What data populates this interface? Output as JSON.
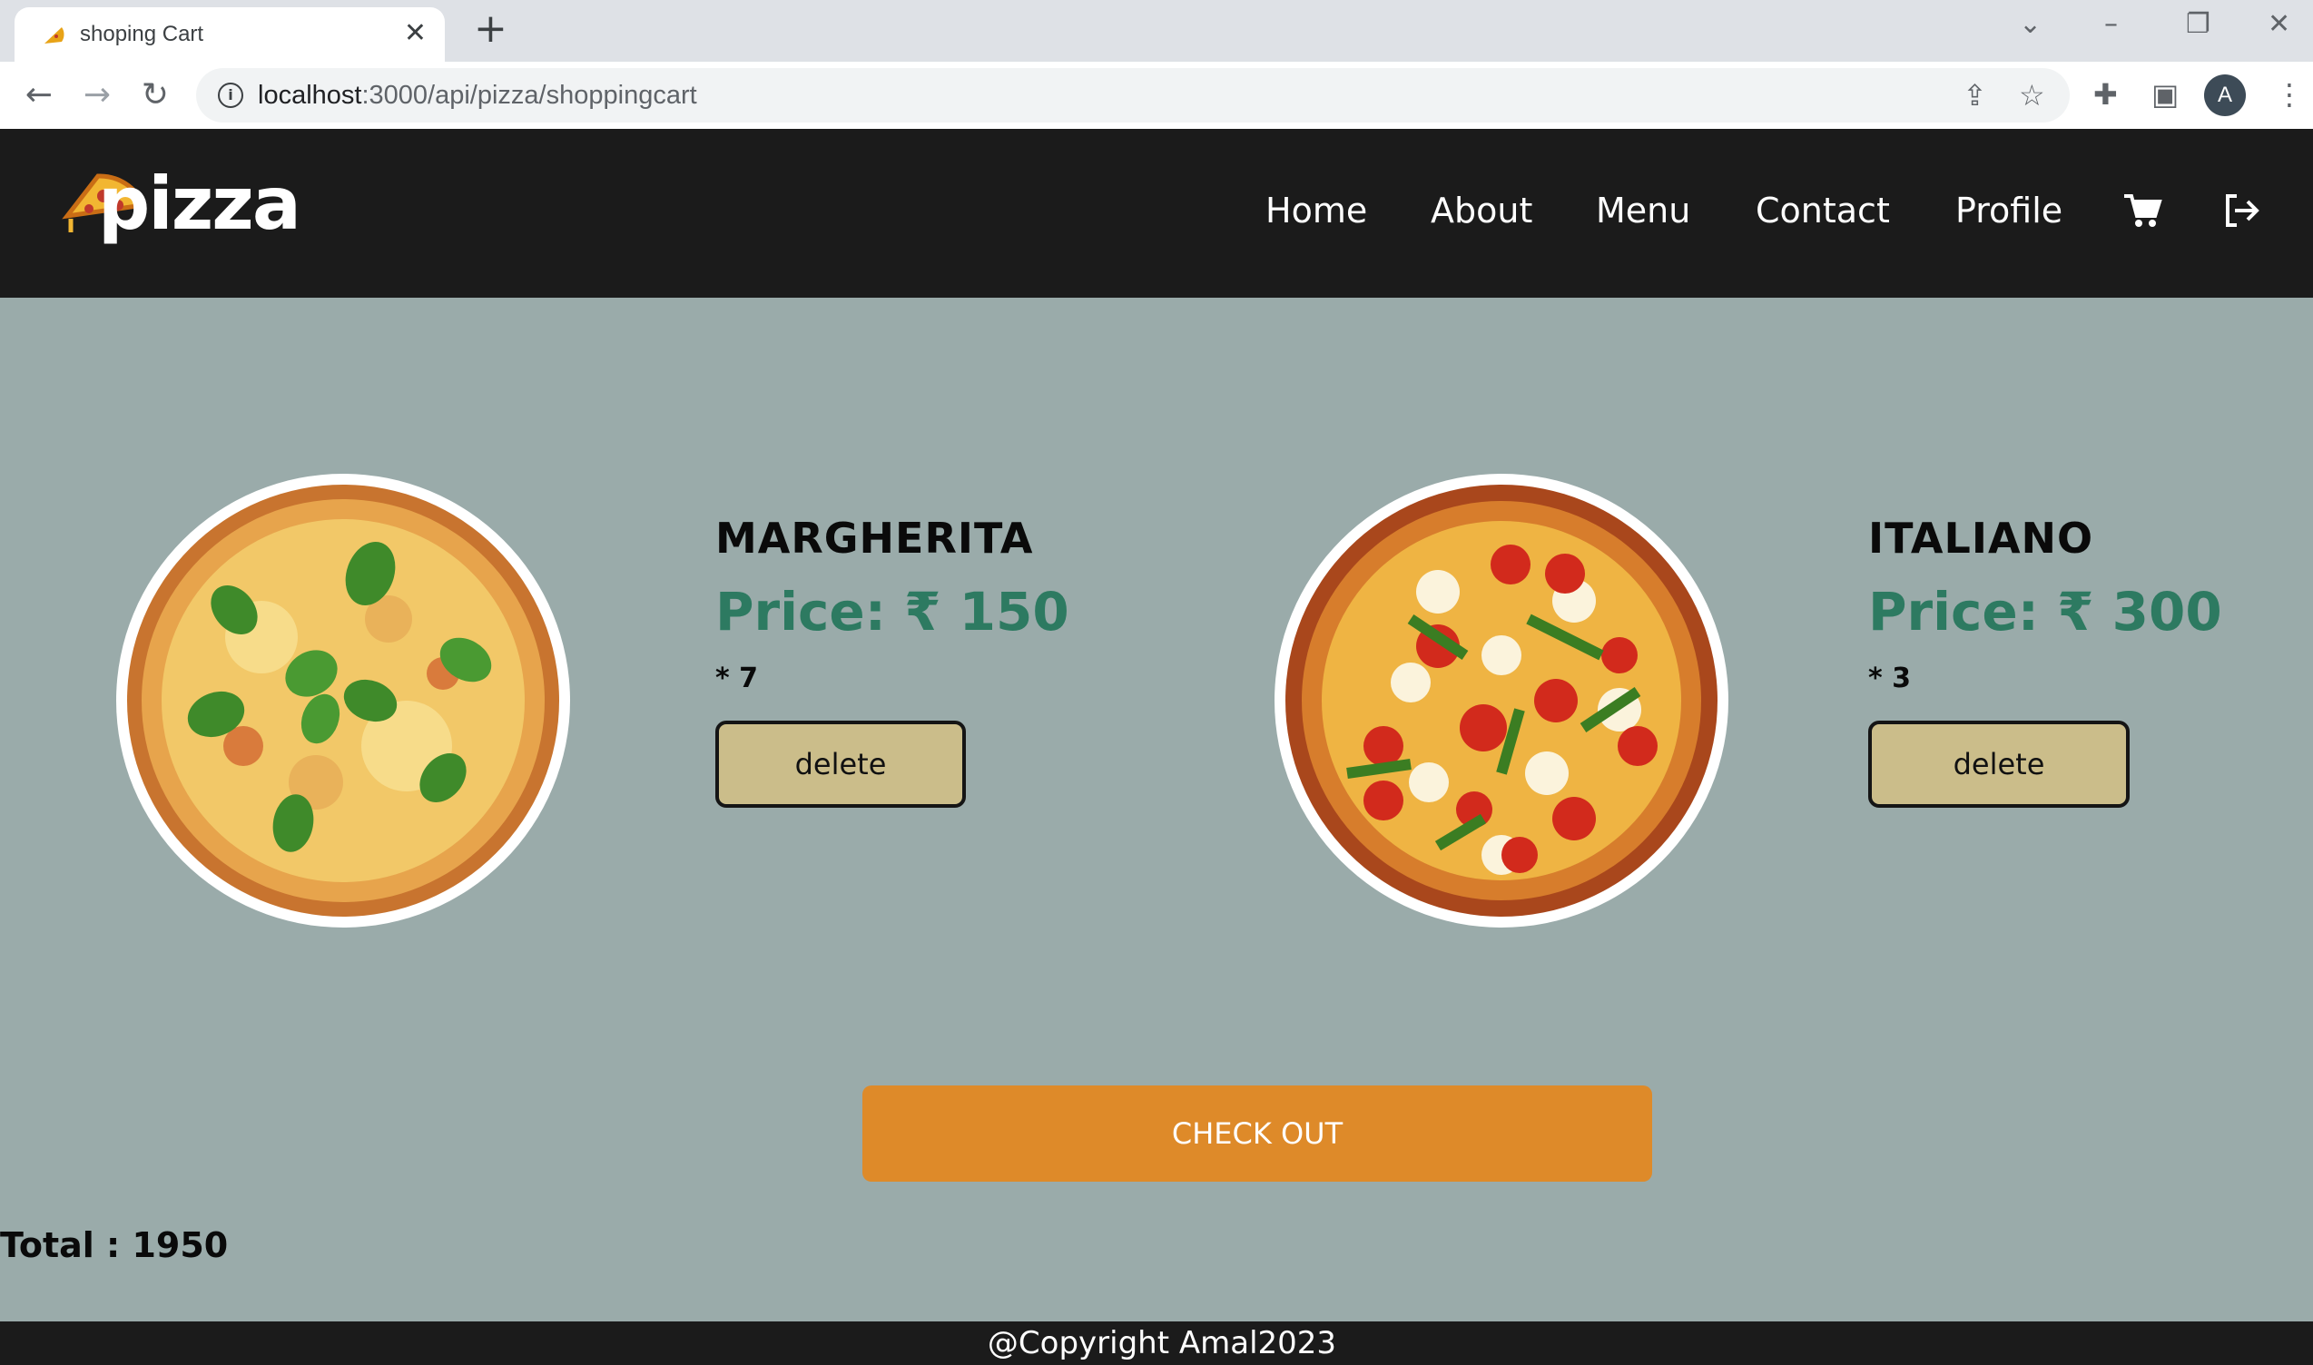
{
  "browser": {
    "tab_title": "shoping Cart",
    "url_host": "localhost",
    "url_path": ":3000/api/pizza/shoppingcart",
    "profile_initial": "A"
  },
  "site": {
    "logo_text": "pizza",
    "nav": [
      "Home",
      "About",
      "Menu",
      "Contact",
      "Profile"
    ],
    "icons": {
      "cart": "cart-icon",
      "logout": "logout-icon"
    }
  },
  "cart": {
    "items": [
      {
        "name": "MARGHERITA",
        "price": "Price: ₹ 150",
        "qty": "* 7",
        "delete_label": "delete"
      },
      {
        "name": "ITALIANO",
        "price": "Price: ₹ 300",
        "qty": "* 3",
        "delete_label": "delete"
      }
    ],
    "checkout_label": "CHECK OUT",
    "total": "Total : 1950"
  },
  "footer": {
    "text": "@Copyright Amal2023"
  },
  "colors": {
    "page_bg": "#9aabaa",
    "header_bg": "#1b1b1b",
    "price": "#2d7a61",
    "delete_btn": "#cbbd8a",
    "checkout_btn": "#de8a29"
  }
}
